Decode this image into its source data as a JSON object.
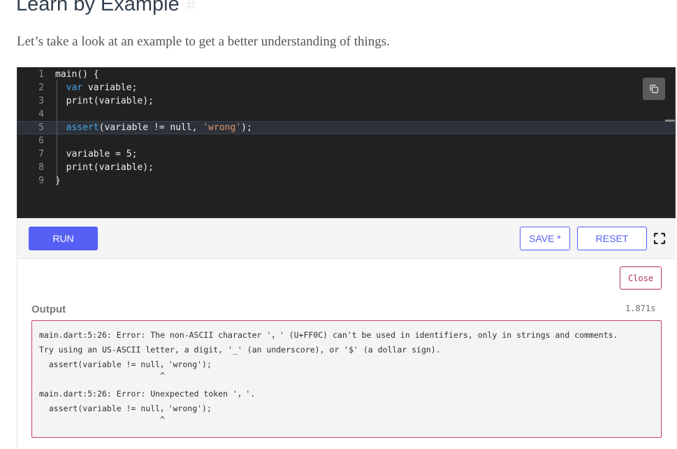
{
  "heading": {
    "title": "Learn by Example",
    "anchor": "#"
  },
  "intro": "Let’s take a look at an example to get a better understanding of things.",
  "editor": {
    "lines": [
      {
        "num": "1",
        "indent": "",
        "segs": [
          {
            "t": "main() {",
            "c": "plain"
          }
        ]
      },
      {
        "num": "2",
        "indent": "  ",
        "segs": [
          {
            "t": "var",
            "c": "kw"
          },
          {
            "t": " variable;",
            "c": "plain"
          }
        ]
      },
      {
        "num": "3",
        "indent": "  ",
        "segs": [
          {
            "t": "print(variable);",
            "c": "plain"
          }
        ]
      },
      {
        "num": "4",
        "indent": "",
        "segs": []
      },
      {
        "num": "5",
        "indent": "  ",
        "active": true,
        "segs": [
          {
            "t": "assert",
            "c": "kw"
          },
          {
            "t": "(variable != null, ",
            "c": "plain"
          },
          {
            "t": "'wrong'",
            "c": "str"
          },
          {
            "t": ");",
            "c": "plain"
          }
        ]
      },
      {
        "num": "6",
        "indent": "",
        "segs": []
      },
      {
        "num": "7",
        "indent": "  ",
        "segs": [
          {
            "t": "variable = 5;",
            "c": "plain"
          }
        ]
      },
      {
        "num": "8",
        "indent": "  ",
        "segs": [
          {
            "t": "print(variable);",
            "c": "plain"
          }
        ]
      },
      {
        "num": "9",
        "indent": "",
        "segs": [
          {
            "t": "}",
            "c": "plain"
          }
        ]
      }
    ],
    "copy_icon": "copy-icon"
  },
  "toolbar": {
    "run_label": "RUN",
    "save_label": "SAVE *",
    "reset_label": "RESET",
    "fullscreen_icon": "fullscreen-icon"
  },
  "output": {
    "close_label": "Close",
    "label": "Output",
    "elapsed": "1.871s",
    "lines": [
      "main.dart:5:26: Error: The non-ASCII character '，' (U+FF0C) can't be used in identifiers, only in strings and comments.",
      "Try using an US-ASCII letter, a digit, '_' (an underscore), or '$' (a dollar sign).",
      "  assert(variable != null，'wrong');",
      "                         ^",
      "",
      "main.dart:5:26: Error: Unexpected token '，'.",
      "  assert(variable != null，'wrong');",
      "                         ^"
    ]
  },
  "colors": {
    "accent": "#5660f5",
    "error_border": "#c2435f",
    "editor_bg": "#212121"
  }
}
